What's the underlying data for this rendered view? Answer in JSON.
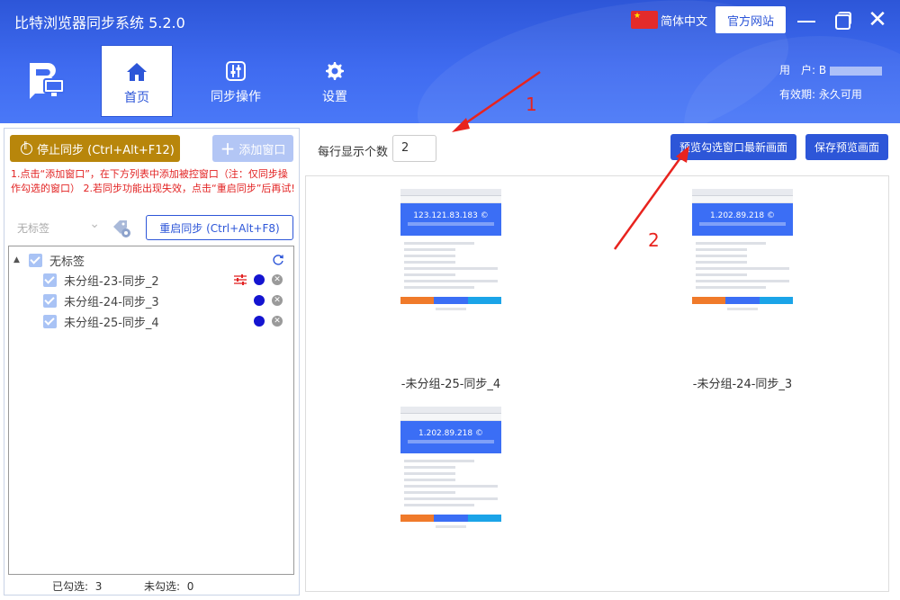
{
  "app": {
    "title": "比特浏览器同步系统 5.2.0",
    "language": "简体中文",
    "official_site": "官方网站"
  },
  "nav": {
    "home": "首页",
    "sync": "同步操作",
    "settings": "设置"
  },
  "user": {
    "user_label": "用　户: B",
    "validity_label": "有效期: 永久可用"
  },
  "left": {
    "stop_sync": "停止同步 (Ctrl+Alt+F12)",
    "add_window": "添加窗口",
    "warning": "1.点击“添加窗口”，在下方列表中添加被控窗口（注：仅同步操作勾选的窗口） 2.若同步功能出现失效，点击“重启同步”后再试!",
    "tag_placeholder": "无标签",
    "restart_sync": "重启同步 (Ctrl+Alt+F8)",
    "tree": {
      "group": "无标签",
      "items": [
        {
          "label": "未分组-23-同步_2"
        },
        {
          "label": "未分组-24-同步_3"
        },
        {
          "label": "未分组-25-同步_4"
        }
      ]
    },
    "checked_label": "已勾选:",
    "checked_count": "3",
    "unchecked_label": "未勾选:",
    "unchecked_count": "0"
  },
  "right": {
    "per_row_label": "每行显示个数",
    "per_row_value": "2",
    "preview_button": "预览勾选窗口最新画面",
    "save_button": "保存预览画面",
    "thumbnails": [
      {
        "ip": "123.121.83.183 ©",
        "caption": "-未分组-25-同步_4"
      },
      {
        "ip": "1.202.89.218 ©",
        "caption": "-未分组-24-同步_3"
      },
      {
        "ip": "1.202.89.218 ©",
        "caption": ""
      }
    ]
  },
  "annotations": {
    "arrow1": "1",
    "arrow2": "2",
    "color": "#e8231e"
  },
  "colors": {
    "brand": "#2d56d8",
    "stop_button": "#b8860b",
    "warning_text": "#e22222"
  }
}
